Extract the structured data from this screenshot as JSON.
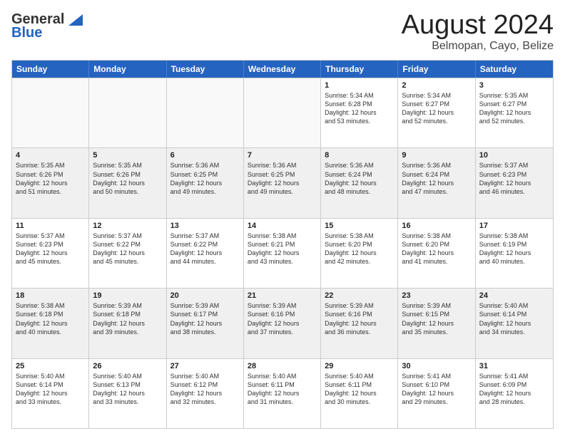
{
  "logo": {
    "general": "General",
    "blue": "Blue"
  },
  "header": {
    "month": "August 2024",
    "location": "Belmopan, Cayo, Belize"
  },
  "days": [
    "Sunday",
    "Monday",
    "Tuesday",
    "Wednesday",
    "Thursday",
    "Friday",
    "Saturday"
  ],
  "rows": [
    [
      {
        "num": "",
        "text": "",
        "empty": true
      },
      {
        "num": "",
        "text": "",
        "empty": true
      },
      {
        "num": "",
        "text": "",
        "empty": true
      },
      {
        "num": "",
        "text": "",
        "empty": true
      },
      {
        "num": "1",
        "text": "Sunrise: 5:34 AM\nSunset: 6:28 PM\nDaylight: 12 hours\nand 53 minutes."
      },
      {
        "num": "2",
        "text": "Sunrise: 5:34 AM\nSunset: 6:27 PM\nDaylight: 12 hours\nand 52 minutes."
      },
      {
        "num": "3",
        "text": "Sunrise: 5:35 AM\nSunset: 6:27 PM\nDaylight: 12 hours\nand 52 minutes."
      }
    ],
    [
      {
        "num": "4",
        "text": "Sunrise: 5:35 AM\nSunset: 6:26 PM\nDaylight: 12 hours\nand 51 minutes.",
        "shaded": true
      },
      {
        "num": "5",
        "text": "Sunrise: 5:35 AM\nSunset: 6:26 PM\nDaylight: 12 hours\nand 50 minutes.",
        "shaded": true
      },
      {
        "num": "6",
        "text": "Sunrise: 5:36 AM\nSunset: 6:25 PM\nDaylight: 12 hours\nand 49 minutes.",
        "shaded": true
      },
      {
        "num": "7",
        "text": "Sunrise: 5:36 AM\nSunset: 6:25 PM\nDaylight: 12 hours\nand 49 minutes.",
        "shaded": true
      },
      {
        "num": "8",
        "text": "Sunrise: 5:36 AM\nSunset: 6:24 PM\nDaylight: 12 hours\nand 48 minutes.",
        "shaded": true
      },
      {
        "num": "9",
        "text": "Sunrise: 5:36 AM\nSunset: 6:24 PM\nDaylight: 12 hours\nand 47 minutes.",
        "shaded": true
      },
      {
        "num": "10",
        "text": "Sunrise: 5:37 AM\nSunset: 6:23 PM\nDaylight: 12 hours\nand 46 minutes.",
        "shaded": true
      }
    ],
    [
      {
        "num": "11",
        "text": "Sunrise: 5:37 AM\nSunset: 6:23 PM\nDaylight: 12 hours\nand 45 minutes."
      },
      {
        "num": "12",
        "text": "Sunrise: 5:37 AM\nSunset: 6:22 PM\nDaylight: 12 hours\nand 45 minutes."
      },
      {
        "num": "13",
        "text": "Sunrise: 5:37 AM\nSunset: 6:22 PM\nDaylight: 12 hours\nand 44 minutes."
      },
      {
        "num": "14",
        "text": "Sunrise: 5:38 AM\nSunset: 6:21 PM\nDaylight: 12 hours\nand 43 minutes."
      },
      {
        "num": "15",
        "text": "Sunrise: 5:38 AM\nSunset: 6:20 PM\nDaylight: 12 hours\nand 42 minutes."
      },
      {
        "num": "16",
        "text": "Sunrise: 5:38 AM\nSunset: 6:20 PM\nDaylight: 12 hours\nand 41 minutes."
      },
      {
        "num": "17",
        "text": "Sunrise: 5:38 AM\nSunset: 6:19 PM\nDaylight: 12 hours\nand 40 minutes."
      }
    ],
    [
      {
        "num": "18",
        "text": "Sunrise: 5:38 AM\nSunset: 6:18 PM\nDaylight: 12 hours\nand 40 minutes.",
        "shaded": true
      },
      {
        "num": "19",
        "text": "Sunrise: 5:39 AM\nSunset: 6:18 PM\nDaylight: 12 hours\nand 39 minutes.",
        "shaded": true
      },
      {
        "num": "20",
        "text": "Sunrise: 5:39 AM\nSunset: 6:17 PM\nDaylight: 12 hours\nand 38 minutes.",
        "shaded": true
      },
      {
        "num": "21",
        "text": "Sunrise: 5:39 AM\nSunset: 6:16 PM\nDaylight: 12 hours\nand 37 minutes.",
        "shaded": true
      },
      {
        "num": "22",
        "text": "Sunrise: 5:39 AM\nSunset: 6:16 PM\nDaylight: 12 hours\nand 36 minutes.",
        "shaded": true
      },
      {
        "num": "23",
        "text": "Sunrise: 5:39 AM\nSunset: 6:15 PM\nDaylight: 12 hours\nand 35 minutes.",
        "shaded": true
      },
      {
        "num": "24",
        "text": "Sunrise: 5:40 AM\nSunset: 6:14 PM\nDaylight: 12 hours\nand 34 minutes.",
        "shaded": true
      }
    ],
    [
      {
        "num": "25",
        "text": "Sunrise: 5:40 AM\nSunset: 6:14 PM\nDaylight: 12 hours\nand 33 minutes."
      },
      {
        "num": "26",
        "text": "Sunrise: 5:40 AM\nSunset: 6:13 PM\nDaylight: 12 hours\nand 33 minutes."
      },
      {
        "num": "27",
        "text": "Sunrise: 5:40 AM\nSunset: 6:12 PM\nDaylight: 12 hours\nand 32 minutes."
      },
      {
        "num": "28",
        "text": "Sunrise: 5:40 AM\nSunset: 6:11 PM\nDaylight: 12 hours\nand 31 minutes."
      },
      {
        "num": "29",
        "text": "Sunrise: 5:40 AM\nSunset: 6:11 PM\nDaylight: 12 hours\nand 30 minutes."
      },
      {
        "num": "30",
        "text": "Sunrise: 5:41 AM\nSunset: 6:10 PM\nDaylight: 12 hours\nand 29 minutes."
      },
      {
        "num": "31",
        "text": "Sunrise: 5:41 AM\nSunset: 6:09 PM\nDaylight: 12 hours\nand 28 minutes."
      }
    ]
  ]
}
